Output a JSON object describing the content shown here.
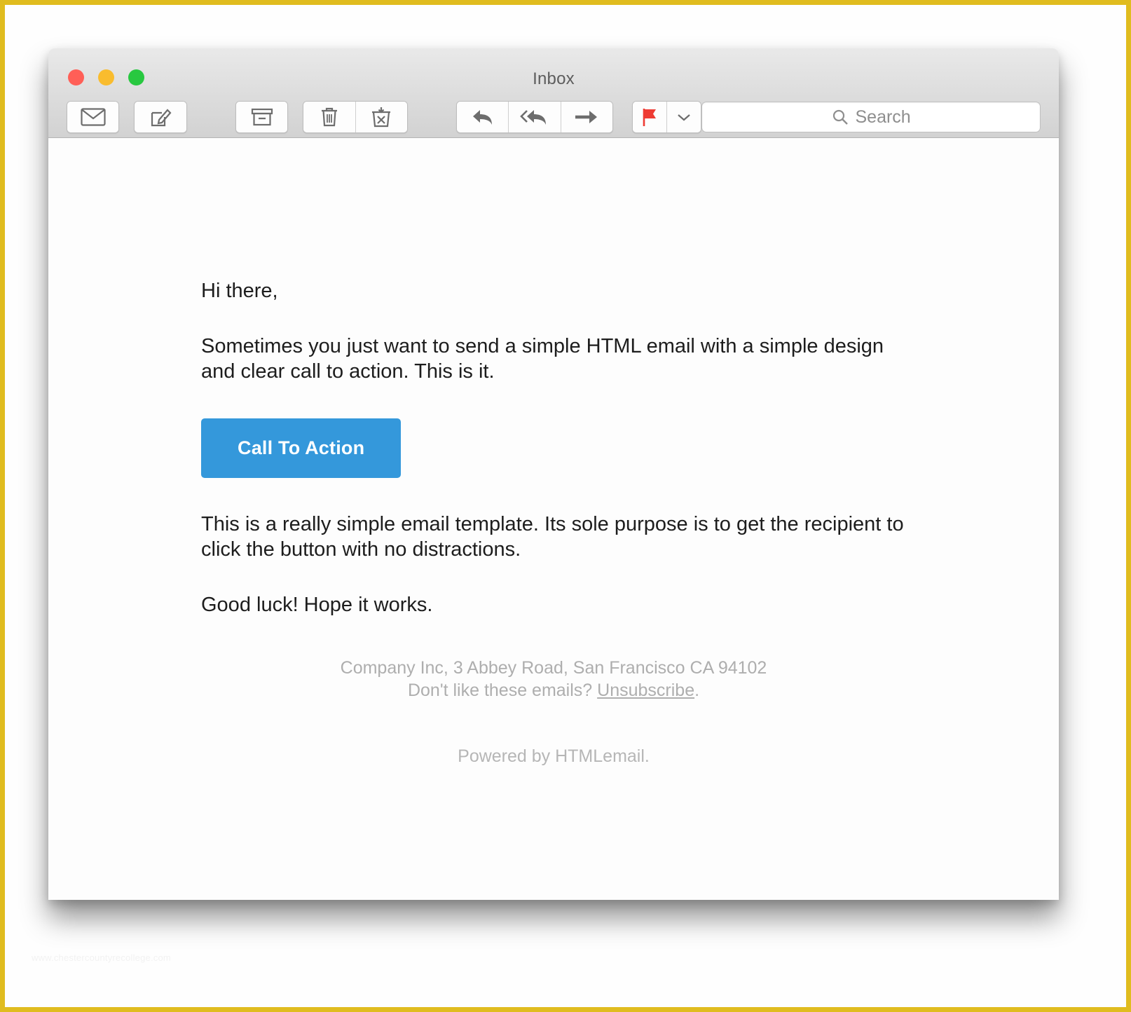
{
  "window": {
    "title": "Inbox",
    "traffic_lights": [
      {
        "name": "close",
        "color": "#ff5f57"
      },
      {
        "name": "minimize",
        "color": "#f9bc2e"
      },
      {
        "name": "zoom",
        "color": "#28c840"
      }
    ]
  },
  "toolbar": {
    "buttons": [
      {
        "name": "get-mail",
        "icon": "envelope-icon"
      },
      {
        "name": "compose",
        "icon": "compose-icon"
      },
      {
        "name": "archive",
        "icon": "archive-icon"
      },
      {
        "name": "delete",
        "icon": "trash-icon"
      },
      {
        "name": "junk",
        "icon": "junk-icon"
      },
      {
        "name": "reply",
        "icon": "reply-arrow-icon"
      },
      {
        "name": "reply-all",
        "icon": "reply-all-arrow-icon"
      },
      {
        "name": "forward",
        "icon": "forward-arrow-icon"
      },
      {
        "name": "flag",
        "icon": "flag-icon"
      },
      {
        "name": "flag-menu",
        "icon": "chevron-down-icon"
      }
    ],
    "flag_color": "#ee3b33"
  },
  "search": {
    "placeholder": "Search",
    "value": "",
    "icon": "search-icon"
  },
  "email": {
    "greeting": "Hi there,",
    "paragraph_1": "Sometimes you just want to send a simple HTML email with a simple design and clear call to action. This is it.",
    "cta_label": "Call To Action",
    "cta_color": "#3498db",
    "paragraph_2": "This is a really simple email template. Its sole purpose is to get the recipient to click the button with no distractions.",
    "paragraph_3": "Good luck! Hope it works."
  },
  "footer": {
    "address": "Company Inc, 3 Abbey Road, San Francisco CA 94102",
    "unsubscribe_prefix": "Don't like these emails? ",
    "unsubscribe_label": "Unsubscribe",
    "unsubscribe_suffix": ".",
    "powered_by": "Powered by HTMLemail."
  },
  "watermark": {
    "text": "www.chestercountyrecollege.com"
  }
}
